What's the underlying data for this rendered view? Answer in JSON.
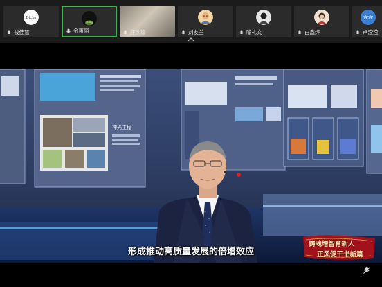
{
  "participants": [
    {
      "name": "钱佳慧",
      "avatar_color": "#ffffff",
      "tag": "Djchy"
    },
    {
      "name": "金蕙丽",
      "avatar_color": "#111111",
      "active": true
    },
    {
      "name": "庄欣瑜",
      "avatar_color": "#c9c2b4"
    },
    {
      "name": "刘友兰",
      "avatar_color": "#e9b277"
    },
    {
      "name": "喻礼文",
      "avatar_color": "#d8d8d8"
    },
    {
      "name": "白鑫烨",
      "avatar_color": "#e8c8a8"
    },
    {
      "name": "卢滢滢",
      "avatar_color": "#3c7fd1",
      "initials": "滢滢"
    }
  ],
  "video": {
    "subtitle": "形成推动高质量发展的倍增效应",
    "slogan_line1": "铸魂增智育新人",
    "slogan_line2": "正风促干书新篇",
    "exhibit_label": "神光工程"
  },
  "colors": {
    "active_border": "#3fb34f",
    "top_bar": "#1b1b1b",
    "slogan_bg": "#a3121c"
  }
}
